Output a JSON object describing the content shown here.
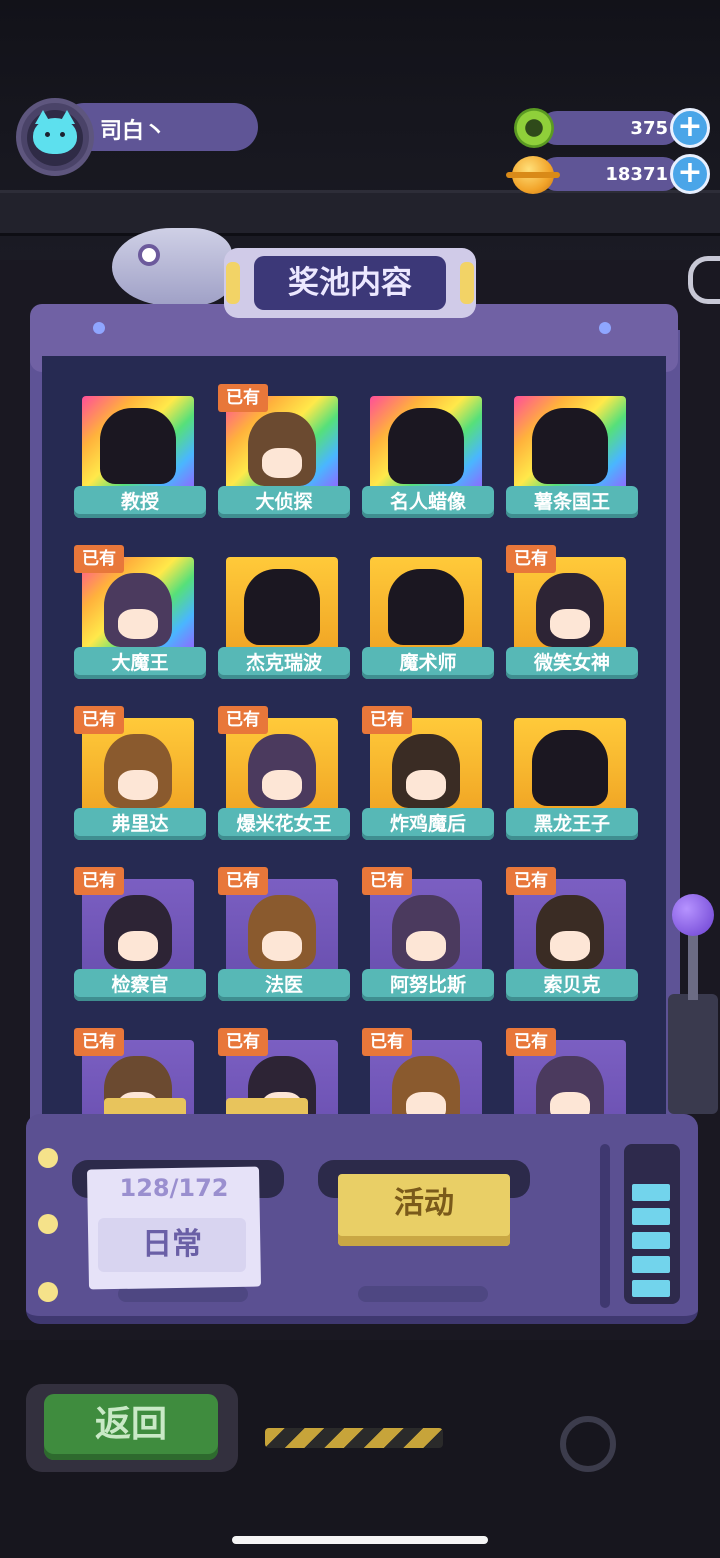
{
  "user": {
    "name": "司白丶"
  },
  "currencies": [
    {
      "id": "green-coin",
      "value": "375",
      "icon": "green-donut-coin-icon"
    },
    {
      "id": "gold-coin",
      "value": "18371",
      "icon": "gold-planet-coin-icon"
    }
  ],
  "title": "奖池内容",
  "owned_label": "已有",
  "cards": [
    {
      "name": "教授",
      "frame": "rainbow",
      "owned": false
    },
    {
      "name": "大侦探",
      "frame": "rainbow",
      "owned": true
    },
    {
      "name": "名人蜡像",
      "frame": "rainbow",
      "owned": false
    },
    {
      "name": "薯条国王",
      "frame": "rainbow",
      "owned": false
    },
    {
      "name": "大魔王",
      "frame": "rainbow",
      "owned": true
    },
    {
      "name": "杰克瑞波",
      "frame": "gold",
      "owned": false
    },
    {
      "name": "魔术师",
      "frame": "gold",
      "owned": false
    },
    {
      "name": "微笑女神",
      "frame": "gold",
      "owned": true
    },
    {
      "name": "弗里达",
      "frame": "gold",
      "owned": true
    },
    {
      "name": "爆米花女王",
      "frame": "gold",
      "owned": true
    },
    {
      "name": "炸鸡魔后",
      "frame": "gold",
      "owned": true
    },
    {
      "name": "黑龙王子",
      "frame": "gold",
      "owned": false
    },
    {
      "name": "检察官",
      "frame": "purple",
      "owned": true
    },
    {
      "name": "法医",
      "frame": "purple",
      "owned": true
    },
    {
      "name": "阿努比斯",
      "frame": "purple",
      "owned": true
    },
    {
      "name": "索贝克",
      "frame": "purple",
      "owned": true
    },
    {
      "name": "",
      "frame": "purple",
      "owned": true
    },
    {
      "name": "",
      "frame": "purple",
      "owned": true
    },
    {
      "name": "",
      "frame": "purple",
      "owned": true
    },
    {
      "name": "",
      "frame": "purple",
      "owned": true
    }
  ],
  "tabs": {
    "daily": {
      "count": "128/172",
      "label": "日常"
    },
    "event": {
      "label": "活动"
    }
  },
  "back_button": "返回",
  "colors": {
    "panel": "#262a52",
    "machine": "#5b5092",
    "label_teal": "#57b8b6",
    "owned_badge": "#e8773a",
    "accent_blue": "#4aa5e8"
  }
}
